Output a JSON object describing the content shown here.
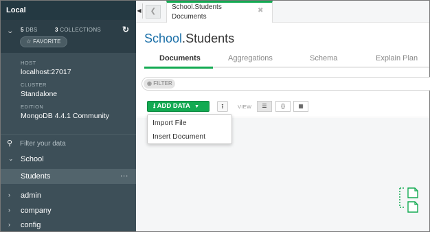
{
  "sidebar": {
    "header": "Local",
    "dbs_count": "5",
    "dbs_label": "DBS",
    "collections_count": "3",
    "collections_label": "COLLECTIONS",
    "favorite_label": "FAVORITE",
    "host_label": "HOST",
    "host_value": "localhost:27017",
    "cluster_label": "CLUSTER",
    "cluster_value": "Standalone",
    "edition_label": "EDITION",
    "edition_value": "MongoDB 4.4.1 Community",
    "filter_placeholder": "Filter your data",
    "databases": [
      {
        "name": "School",
        "expanded": true
      },
      {
        "name": "admin",
        "expanded": false
      },
      {
        "name": "company",
        "expanded": false
      },
      {
        "name": "config",
        "expanded": false
      }
    ],
    "active_collection": "Students",
    "active_collection_menu": "..."
  },
  "tab": {
    "title": "School.Students",
    "subtitle": "Documents"
  },
  "main": {
    "title_db": "School",
    "title_sep": ".",
    "title_collection": "Students",
    "subtabs": [
      "Documents",
      "Aggregations",
      "Schema",
      "Explain Plan"
    ],
    "filter_chip": "FILTER",
    "add_data_label": "ADD DATA",
    "view_label": "VIEW",
    "menu_items": [
      "Import File",
      "Insert Document"
    ]
  },
  "colors": {
    "accent": "#13aa52",
    "sidebar_bg": "#3d4f58",
    "db_title": "#1a6fa8"
  }
}
